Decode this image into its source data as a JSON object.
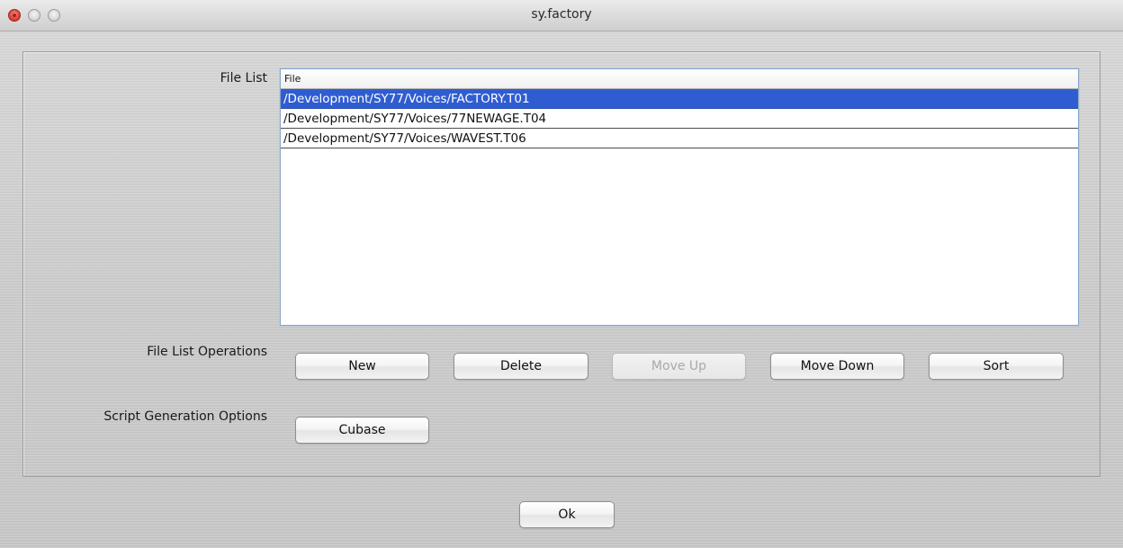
{
  "window": {
    "title": "sy.factory"
  },
  "file_list": {
    "label": "File List",
    "column_header": "File",
    "rows": [
      {
        "path": "/Development/SY77/Voices/FACTORY.T01",
        "selected": true
      },
      {
        "path": "/Development/SY77/Voices/77NEWAGE.T04",
        "selected": false
      },
      {
        "path": "/Development/SY77/Voices/WAVEST.T06",
        "selected": false
      }
    ]
  },
  "file_list_operations": {
    "label": "File List Operations",
    "buttons": {
      "new": "New",
      "delete": "Delete",
      "move_up": "Move Up",
      "move_down": "Move Down",
      "sort": "Sort"
    }
  },
  "script_generation_options": {
    "label": "Script Generation Options",
    "buttons": {
      "cubase": "Cubase"
    }
  },
  "footer": {
    "ok": "Ok"
  },
  "colors": {
    "selection": "#2f5dd1",
    "close_button": "#e0453a"
  },
  "icons": {
    "close": "close-icon",
    "minimize": "minimize-icon",
    "zoom": "zoom-icon"
  }
}
